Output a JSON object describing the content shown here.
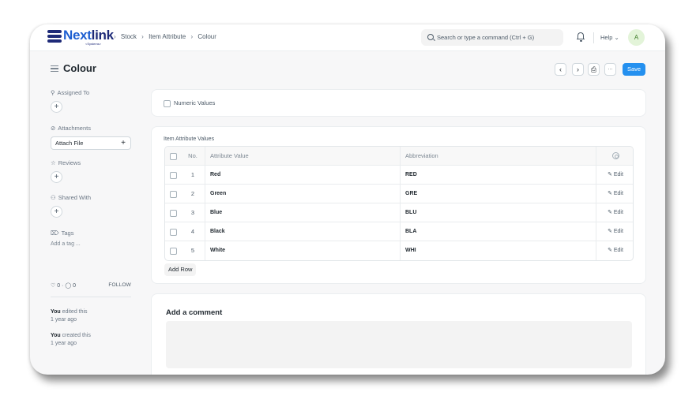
{
  "navbar": {
    "logo_main": "Next",
    "logo_accent": "link",
    "logo_sub": "<Systems>",
    "breadcrumbs": [
      "Stock",
      "Item Attribute",
      "Colour"
    ],
    "search_placeholder": "Search or type a command (Ctrl + G)",
    "help_label": "Help",
    "avatar_initial": "A"
  },
  "page": {
    "title": "Colour",
    "prev_symbol": "‹",
    "next_symbol": "›",
    "print_symbol": "⎙",
    "more_symbol": "···",
    "save_label": "Save"
  },
  "sidebar": {
    "assigned_to": "Assigned To",
    "attachments": "Attachments",
    "attach_file": "Attach File",
    "reviews": "Reviews",
    "shared_with": "Shared With",
    "tags": "Tags",
    "add_tag": "Add a tag ...",
    "likes": "♡ 0 · ◯ 0",
    "follow": "FOLLOW",
    "activity": [
      {
        "who": "You",
        "what": " edited this",
        "when": "1 year ago"
      },
      {
        "who": "You",
        "what": " created this",
        "when": "1 year ago"
      }
    ]
  },
  "form": {
    "numeric_values_label": "Numeric Values",
    "numeric_values_checked": false,
    "table_label": "Item Attribute Values",
    "columns": {
      "no": "No.",
      "value": "Attribute Value",
      "abbr": "Abbreviation"
    },
    "rows": [
      {
        "no": "1",
        "value": "Red",
        "abbr": "RED",
        "edit": "✎ Edit"
      },
      {
        "no": "2",
        "value": "Green",
        "abbr": "GRE",
        "edit": "✎ Edit"
      },
      {
        "no": "3",
        "value": "Blue",
        "abbr": "BLU",
        "edit": "✎ Edit"
      },
      {
        "no": "4",
        "value": "Black",
        "abbr": "BLA",
        "edit": "✎ Edit"
      },
      {
        "no": "5",
        "value": "White",
        "abbr": "WHI",
        "edit": "✎ Edit"
      }
    ],
    "add_row_label": "Add Row"
  },
  "comments": {
    "title": "Add a comment"
  },
  "colors": {
    "primary": "#2490ef",
    "logo_blue": "#1e5fd1",
    "logo_navy": "#1e2a78",
    "avatar_bg": "#e3f4d9"
  }
}
